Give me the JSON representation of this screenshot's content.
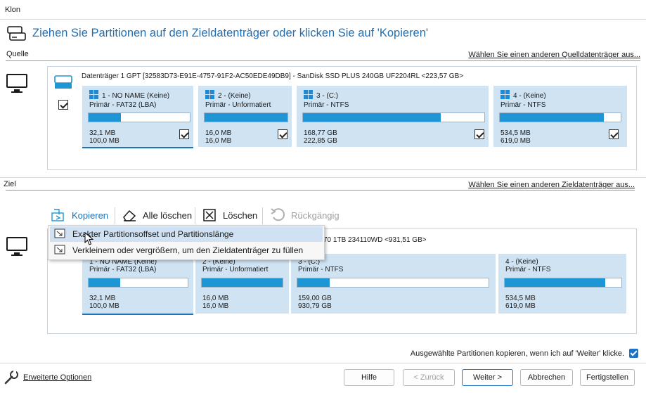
{
  "window": {
    "title": "Klon"
  },
  "header": {
    "title": "Ziehen Sie Partitionen auf den Zieldatenträger oder klicken Sie auf 'Kopieren'",
    "icon": "disk-clone-icon"
  },
  "source": {
    "section_label": "Quelle",
    "change_link": "Wählen Sie einen anderen Quelldatenträger aus...",
    "disk_title": "Datenträger 1 GPT [32583D73-E91E-4757-91F2-AC50EDE49DB9] - SanDisk SSD PLUS 240GB UF2204RL  <223,57 GB>",
    "disk_checked": true,
    "partitions": [
      {
        "title": "1 - NO NAME (Keine)",
        "fs": "Primär - FAT32 (LBA)",
        "used": "32,1 MB",
        "capacity": "100,0 MB",
        "fill": 0.32,
        "checked": true,
        "os_icon": true
      },
      {
        "title": "2 -  (Keine)",
        "fs": "Primär - Unformatiert",
        "used": "16,0 MB",
        "capacity": "16,0 MB",
        "fill": 1.0,
        "checked": true,
        "os_icon": true
      },
      {
        "title": "3 -  (C:)",
        "fs": "Primär - NTFS",
        "used": "168,77 GB",
        "capacity": "222,85 GB",
        "fill": 0.76,
        "checked": true,
        "os_icon": true
      },
      {
        "title": "4 -  (Keine)",
        "fs": "Primär - NTFS",
        "used": "534,5 MB",
        "capacity": "619,0 MB",
        "fill": 0.86,
        "checked": true,
        "os_icon": true
      }
    ]
  },
  "target": {
    "section_label": "Ziel",
    "change_link": "Wählen Sie einen anderen Zieldatenträger aus...",
    "disk_title_visible": "70 1TB 234110WD  <931,51 GB>",
    "partitions": [
      {
        "title": "1 - NO NAME (Keine)",
        "fs": "Primär - FAT32 (LBA)",
        "used": "32,1 MB",
        "capacity": "100,0 MB",
        "fill": 0.32
      },
      {
        "title": "2 -  (Keine)",
        "fs": "Primär - Unformatiert",
        "used": "16,0 MB",
        "capacity": "16,0 MB",
        "fill": 1.0
      },
      {
        "title": "3 -  (C:)",
        "fs": "Primär - NTFS",
        "used": "159,00 GB",
        "capacity": "930,79 GB",
        "fill": 0.17
      },
      {
        "title": "4 -  (Keine)",
        "fs": "Primär - NTFS",
        "used": "534,5 MB",
        "capacity": "619,0 MB",
        "fill": 0.86
      }
    ]
  },
  "toolbar": {
    "copy": "Kopieren",
    "delete_all": "Alle löschen",
    "delete": "Löschen",
    "undo": "Rückgängig"
  },
  "copy_menu": {
    "items": [
      "Exakter Partitionsoffset und Partitionslänge",
      "Verkleinern oder vergrößern, um den Zieldatenträger zu füllen"
    ]
  },
  "footer": {
    "auto_copy_label": "Ausgewählte Partitionen kopieren, wenn ich auf 'Weiter' klicke.",
    "auto_copy_checked": true,
    "advanced_link": "Erweiterte Optionen",
    "buttons": {
      "help": "Hilfe",
      "back": "< Zurück",
      "next": "Weiter >",
      "cancel": "Abbrechen",
      "finish": "Fertigstellen"
    }
  },
  "colors": {
    "accent": "#1e95d4",
    "partition_bg": "#cfe3f3",
    "title_blue": "#1f6fb5"
  }
}
